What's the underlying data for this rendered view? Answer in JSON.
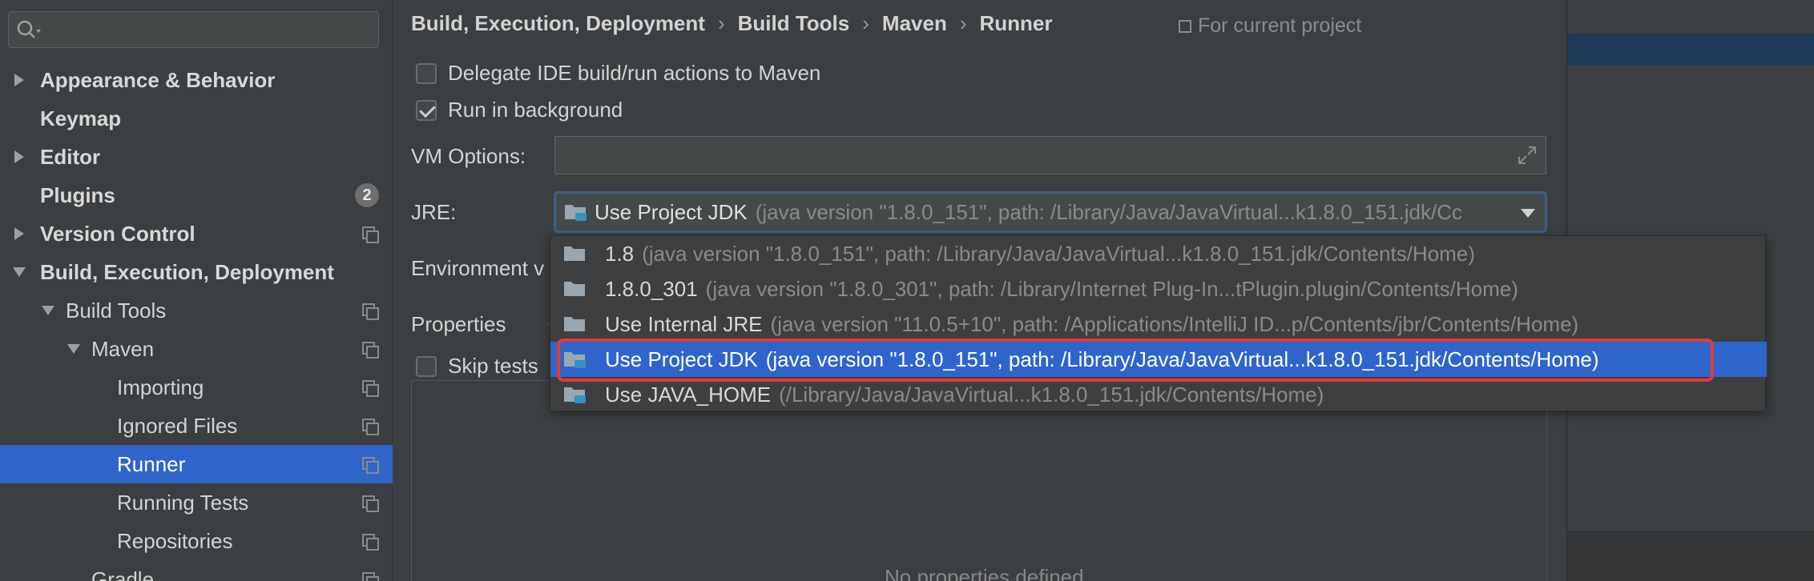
{
  "sidebar": {
    "search_placeholder": "",
    "items": [
      {
        "label": "Appearance & Behavior"
      },
      {
        "label": "Keymap"
      },
      {
        "label": "Editor"
      },
      {
        "label": "Plugins",
        "badge": "2"
      },
      {
        "label": "Version Control"
      },
      {
        "label": "Build, Execution, Deployment"
      },
      {
        "label": "Build Tools"
      },
      {
        "label": "Maven"
      },
      {
        "label": "Importing"
      },
      {
        "label": "Ignored Files"
      },
      {
        "label": "Runner"
      },
      {
        "label": "Running Tests"
      },
      {
        "label": "Repositories"
      },
      {
        "label": "Gradle"
      }
    ]
  },
  "breadcrumb": [
    "Build, Execution, Deployment",
    "Build Tools",
    "Maven",
    "Runner"
  ],
  "for_project": "For current project",
  "options": {
    "delegate": "Delegate IDE build/run actions to Maven",
    "run_bg": "Run in background",
    "vm_label": "VM Options:",
    "jre_label": "JRE:",
    "env_label": "Environment v",
    "properties": "Properties",
    "skip_tests": "Skip tests",
    "no_props": "No properties defined"
  },
  "jre": {
    "selected_name": "Use Project JDK",
    "selected_detail": "(java version \"1.8.0_151\", path: /Library/Java/JavaVirtual...k1.8.0_151.jdk/Cc"
  },
  "dropdown": [
    {
      "name": "1.8",
      "detail": "(java version \"1.8.0_151\", path: /Library/Java/JavaVirtual...k1.8.0_151.jdk/Contents/Home)"
    },
    {
      "name": "1.8.0_301",
      "detail": "(java version \"1.8.0_301\", path: /Library/Internet Plug-In...tPlugin.plugin/Contents/Home)"
    },
    {
      "name": "Use Internal JRE",
      "detail": "(java version \"11.0.5+10\", path: /Applications/IntelliJ ID...p/Contents/jbr/Contents/Home)"
    },
    {
      "name": "Use Project JDK",
      "detail": "(java version \"1.8.0_151\", path: /Library/Java/JavaVirtual...k1.8.0_151.jdk/Contents/Home)"
    },
    {
      "name": "Use JAVA_HOME",
      "detail": "(/Library/Java/JavaVirtual...k1.8.0_151.jdk/Contents/Home)"
    }
  ],
  "colors": {
    "selection": "#2f65ca",
    "highlight_border": "#e03a3a",
    "background": "#3c3f41"
  }
}
